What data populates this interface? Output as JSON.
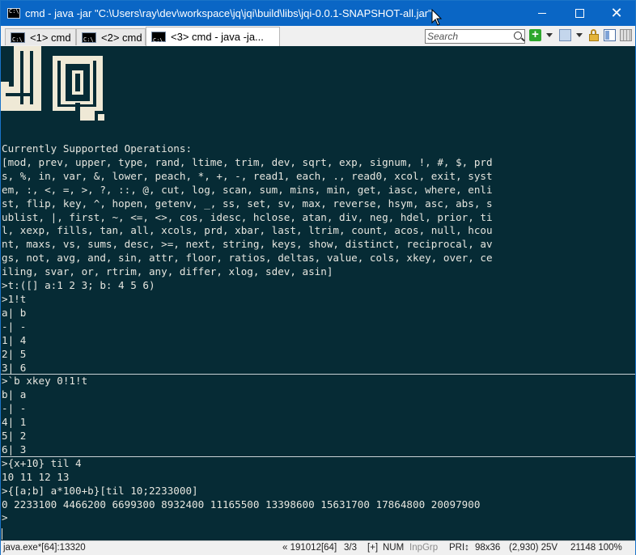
{
  "window": {
    "title": "cmd - java  -jar \"C:\\Users\\ray\\dev\\workspace\\jq\\jqi\\build\\libs\\jqi-0.0.1-SNAPSHOT-all.jar\"",
    "minimize": "minimize",
    "maximize": "maximize",
    "close": "close"
  },
  "tabs": [
    {
      "label": "<1> cmd",
      "active": false
    },
    {
      "label": "<2> cmd",
      "active": false
    },
    {
      "label": "<3> cmd - java  -ja...",
      "active": true
    }
  ],
  "toolbar": {
    "search_placeholder": "Search",
    "icons": [
      "console-icon",
      "search-icon",
      "new-console-plus-icon",
      "dropdown-arrow-icon",
      "console-options-icon",
      "lock-icon",
      "panel-icon",
      "grid-icon"
    ]
  },
  "console": {
    "logo_text": "JQ",
    "lines": [
      "Currently Supported Operations:",
      "[mod, prev, upper, type, rand, ltime, trim, dev, sqrt, exp, signum, !, #, $, prd",
      "s, %, in, var, &, lower, peach, *, +, -, read1, each, ., read0, xcol, exit, syst",
      "em, :, <, =, >, ?, ::, @, cut, log, scan, sum, mins, min, get, iasc, where, enli",
      "st, flip, key, ^, hopen, getenv, _, ss, set, sv, max, reverse, hsym, asc, abs, s",
      "ublist, |, first, ~, <=, <>, cos, idesc, hclose, atan, div, neg, hdel, prior, ti",
      "l, xexp, fills, tan, all, xcols, prd, xbar, last, ltrim, count, acos, null, hcou",
      "nt, maxs, vs, sums, desc, >=, next, string, keys, show, distinct, reciprocal, av",
      "gs, not, avg, and, sin, attr, floor, ratios, deltas, value, cols, xkey, over, ce",
      "iling, svar, or, rtrim, any, differ, xlog, sdev, asin]",
      ">t:([] a:1 2 3; b: 4 5 6)",
      ">1!t",
      "a| b",
      "-| -",
      "1| 4",
      "2| 5",
      "3| 6",
      ">`b xkey 0!1!t",
      "b| a",
      "-| -",
      "4| 1",
      "5| 2",
      "6| 3",
      ">{x+10} til 4",
      "10 11 12 13",
      ">{[a;b] a*100+b}[til 10;2233000]",
      "0 2233100 4466200 6699300 8932400 11165500 13398600 15631700 17864800 20097900",
      ">"
    ]
  },
  "status": {
    "process": "java.exe*[64]:13320",
    "build": "« 191012[64]",
    "console_index": "3/3",
    "insert": "[+]",
    "num": "NUM",
    "inp_grp": "InpGrp",
    "pri": "PRI↕",
    "size": "98x36",
    "cursor": "(2,930) 25V",
    "pid_zoom": "21148 100%"
  },
  "colors": {
    "titlebar": "#0a66c5",
    "console_bg": "#062b35",
    "console_fg": "#e6e6df",
    "logo": "#efe9d6"
  }
}
